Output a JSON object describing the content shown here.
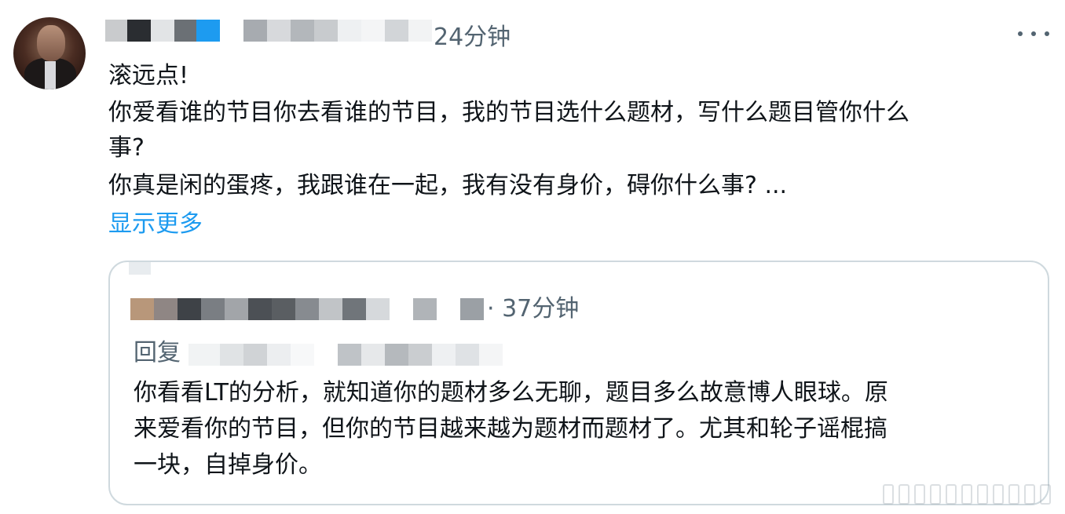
{
  "tweet": {
    "timestamp": "24分钟",
    "more_icon": "more-horizontal-icon",
    "lines": [
      "滚远点!",
      "你爱看谁的节目你去看谁的节目，我的节目选什么题材，写什么题目管你什么",
      "事?",
      "你真是闲的蛋疼，我跟谁在一起，我有没有身价，碍你什么事? ..."
    ],
    "show_more": "显示更多"
  },
  "quote": {
    "timestamp": "· 37分钟",
    "reply_label": "回复",
    "lines": [
      "你看看LT的分析，就知道你的题材多么无聊，题目多么故意博人眼球。原",
      "来爱看你的节目，但你的节目越来越为题材而题材了。尤其和轮子谣棍搞",
      "一块，自掉身价。"
    ]
  },
  "colors": {
    "accent": "#1d9bf0",
    "secondary_text": "#536471",
    "border": "#cfd9de"
  }
}
